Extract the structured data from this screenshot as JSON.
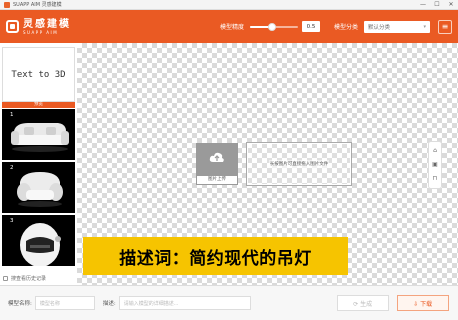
{
  "window": {
    "title": "SUAPP AIM 灵感建模",
    "minimize_glyph": "—",
    "maximize_glyph": "☐",
    "close_glyph": "✕"
  },
  "header": {
    "logo_cn": "灵感建模",
    "logo_en": "SUAPP AIM",
    "precision_label": "模型精度",
    "precision_value": "0.5",
    "precision_fraction": 0.45,
    "category_label": "模型分类",
    "category_selected": "默认分类",
    "menu_glyph": "≡"
  },
  "sidebar": {
    "text_to_3d_label": "Text to 3D",
    "selected_tag": "预览",
    "thumbnails": [
      {
        "number": "1",
        "subject": "white-sofa"
      },
      {
        "number": "2",
        "subject": "white-armchair"
      },
      {
        "number": "3",
        "subject": "white-helmet"
      }
    ],
    "history_label": "搜查看历史记录"
  },
  "canvas": {
    "upload_label": "图片上传",
    "drop_hint": "长按图片可直接拖入图片文件",
    "tool_icons": [
      "⌂",
      "▣",
      "⊓"
    ]
  },
  "caption": {
    "text": "描述词：简约现代的吊灯"
  },
  "bottom": {
    "model_name_label": "模型名称:",
    "model_name_placeholder": "模型名称",
    "desc_label": "描述:",
    "desc_placeholder": "请输入模型的详细描述...",
    "generate_label": "⟳ 生成",
    "download_label": "⇩ 下载"
  },
  "colors": {
    "brand": "#ea5a23",
    "caption_bg": "#f6c400"
  }
}
